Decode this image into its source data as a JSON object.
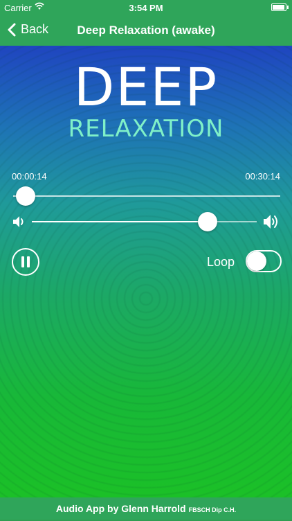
{
  "status_bar": {
    "carrier": "Carrier",
    "time": "3:54 PM"
  },
  "nav": {
    "back_label": "Back",
    "title": "Deep Relaxation (awake)"
  },
  "artwork": {
    "title": "DEEP",
    "subtitle": "RELAXATION"
  },
  "player": {
    "elapsed": "00:00:14",
    "total": "00:30:14",
    "progress_fraction": 0.008,
    "volume_fraction": 0.78,
    "state": "playing"
  },
  "loop": {
    "label": "Loop",
    "enabled": false
  },
  "footer": {
    "credit": "Audio App by Glenn Harrold",
    "qualifications": "FBSCH Dip C.H."
  },
  "colors": {
    "bar_green": "#2fa55a",
    "gradient_top": "#1f45c0",
    "gradient_bottom": "#1bc027",
    "subtitle_mint": "#7ff0c8"
  },
  "icons": {
    "back": "chevron-left-icon",
    "wifi": "wifi-icon",
    "battery": "battery-icon",
    "volume_low": "volume-low-icon",
    "volume_high": "volume-high-icon",
    "pause": "pause-icon"
  }
}
